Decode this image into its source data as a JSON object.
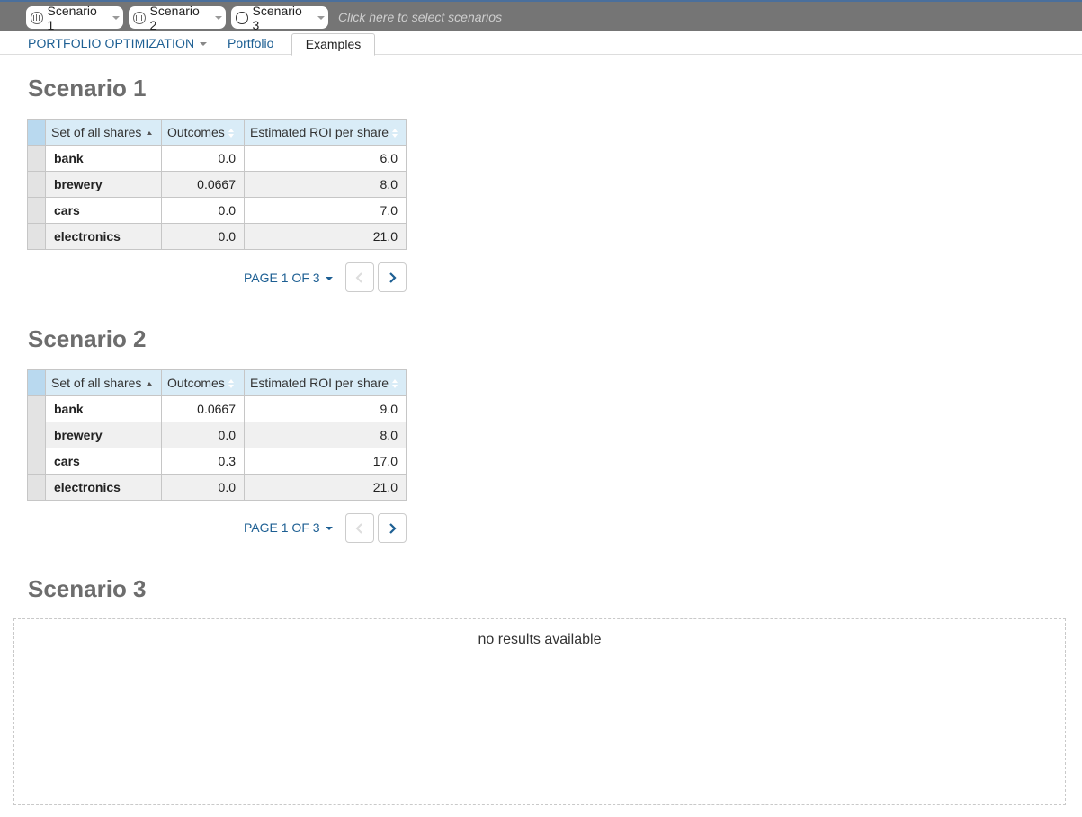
{
  "scenario_bar": {
    "pills": [
      {
        "label": "Scenario 1",
        "icon": "chart-icon"
      },
      {
        "label": "Scenario 2",
        "icon": "chart-icon"
      },
      {
        "label": "Scenario 3",
        "icon": "circle-icon"
      }
    ],
    "select_hint": "Click here to select scenarios"
  },
  "nav": {
    "app_title": "PORTFOLIO OPTIMIZATION",
    "tabs": [
      {
        "label": "Portfolio"
      },
      {
        "label": "Examples"
      }
    ]
  },
  "scenarios": [
    {
      "title": "Scenario 1",
      "columns": [
        "Set of all shares",
        "Outcomes",
        "Estimated ROI per share"
      ],
      "rows": [
        [
          "bank",
          "0.0",
          "6.0"
        ],
        [
          "brewery",
          "0.0667",
          "8.0"
        ],
        [
          "cars",
          "0.0",
          "7.0"
        ],
        [
          "electronics",
          "0.0",
          "21.0"
        ]
      ],
      "pager": "PAGE 1 OF 3"
    },
    {
      "title": "Scenario 2",
      "columns": [
        "Set of all shares",
        "Outcomes",
        "Estimated ROI per share"
      ],
      "rows": [
        [
          "bank",
          "0.0667",
          "9.0"
        ],
        [
          "brewery",
          "0.0",
          "8.0"
        ],
        [
          "cars",
          "0.3",
          "17.0"
        ],
        [
          "electronics",
          "0.0",
          "21.0"
        ]
      ],
      "pager": "PAGE 1 OF 3"
    },
    {
      "title": "Scenario 3",
      "empty_message": "no results available"
    }
  ],
  "colors": {
    "topbar": "#757575",
    "link": "#1d5f93",
    "header_bg": "#d9ecf7"
  }
}
